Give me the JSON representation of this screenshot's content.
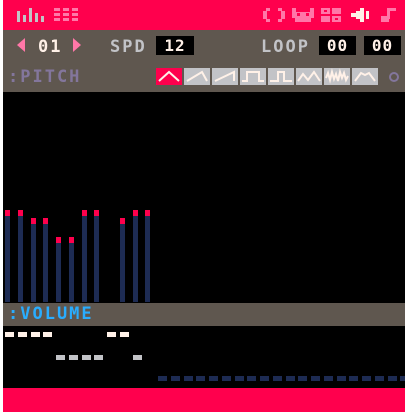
{
  "window": {
    "accent": "#ff004d",
    "panel": "#5f574f"
  },
  "topbar": {
    "left_icons": [
      "bar-chart-icon",
      "grid-icon"
    ],
    "right_icons": [
      "code-icon",
      "sprite-icon",
      "map-icon",
      "sfx-icon",
      "music-icon"
    ]
  },
  "controls": {
    "sfx_number": "01",
    "speed_label": "SPD",
    "speed_value": "12",
    "loop_label": "LOOP",
    "loop_start": "00",
    "loop_end": "00"
  },
  "pitch": {
    "label": ":PITCH",
    "waveforms": [
      "triangle",
      "tilted-saw",
      "saw",
      "square",
      "pulse",
      "organ",
      "noise",
      "phaser"
    ],
    "selected_waveform": "triangle"
  },
  "volume": {
    "label": ":VOLUME"
  },
  "pitch_bars": [
    {
      "step": 0,
      "level": 0.44
    },
    {
      "step": 1,
      "level": 0.44
    },
    {
      "step": 2,
      "level": 0.4
    },
    {
      "step": 3,
      "level": 0.4
    },
    {
      "step": 4,
      "level": 0.31
    },
    {
      "step": 5,
      "level": 0.31
    },
    {
      "step": 6,
      "level": 0.44
    },
    {
      "step": 7,
      "level": 0.44
    },
    {
      "step": 9,
      "level": 0.4
    },
    {
      "step": 10,
      "level": 0.44
    },
    {
      "step": 11,
      "level": 0.44
    }
  ],
  "volume_levels": [
    7,
    7,
    7,
    7,
    6,
    6,
    6,
    6,
    7,
    7,
    6,
    0,
    0,
    0,
    0,
    0,
    0,
    0,
    0,
    0,
    0,
    0,
    0,
    0,
    0,
    0,
    0,
    0,
    0,
    0,
    0,
    0
  ]
}
